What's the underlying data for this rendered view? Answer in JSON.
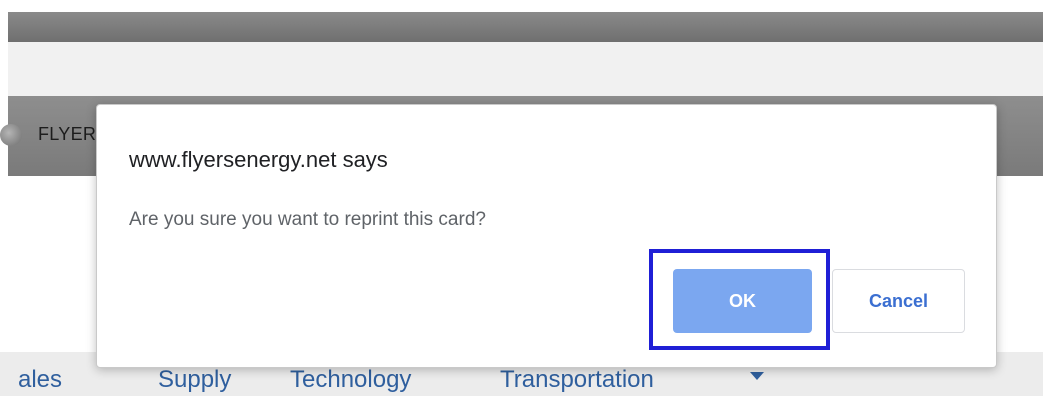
{
  "browser": {
    "brand_text": "FLYER"
  },
  "dialog": {
    "title": "www.flyersenergy.net says",
    "message": "Are you sure you want to reprint this card?",
    "ok_label": "OK",
    "cancel_label": "Cancel"
  },
  "nav": {
    "items": [
      "Sales",
      "Supply",
      "Technology",
      "Transportation"
    ],
    "partial_first_item": "ales"
  },
  "colors": {
    "ok_button": "#7ba7f0",
    "highlight": "#1f1fd6",
    "nav_link": "#2f5f9e"
  }
}
